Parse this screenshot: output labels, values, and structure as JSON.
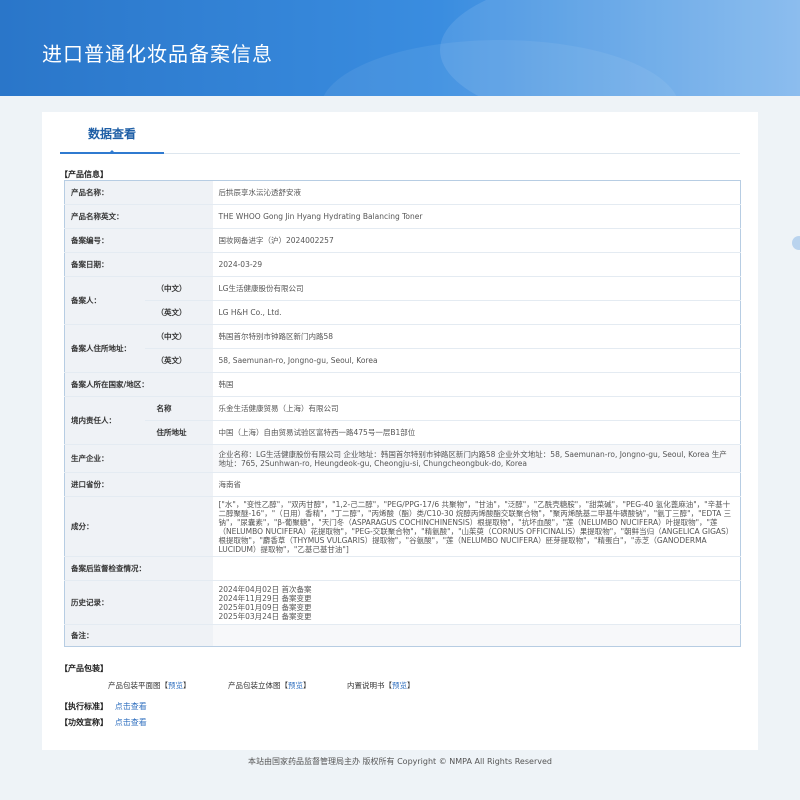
{
  "header": {
    "title": "进口普通化妆品备案信息"
  },
  "tabs": [
    {
      "label": "数据查看"
    }
  ],
  "sections": {
    "product_info": "【产品信息】",
    "packaging": "【产品包装】",
    "standard": "【执行标准】",
    "efficacy": "【功效宣称】"
  },
  "fields": {
    "name_label": "产品名称：",
    "name": "后拱辰享水沄沁透舒安液",
    "name_en_label": "产品名称英文：",
    "name_en": "THE WHOO Gong Jin Hyang Hydrating Balancing Toner",
    "record_no_label": "备案编号：",
    "record_no": "国妆网备进字（沪）2024002257",
    "record_date_label": "备案日期：",
    "record_date": "2024-03-29",
    "registrant_label": "备案人：",
    "cn_label": "（中文）",
    "en_label": "（英文）",
    "registrant_cn": "LG生活健康股份有限公司",
    "registrant_en": "LG H&H Co., Ltd.",
    "address_label": "备案人住所地址：",
    "address_cn": "韩国首尔特别市钟路区新门内路58",
    "address_en": "58, Saemunan-ro, Jongno-gu, Seoul, Korea",
    "country_label": "备案人所在国家/地区：",
    "country": "韩国",
    "domestic_label": "境内责任人：",
    "domestic_name_label": "名称",
    "domestic_name": "乐金生活健康贸易（上海）有限公司",
    "domestic_addr_label": "住所地址",
    "domestic_addr": "中国（上海）自由贸易试验区富特西一路475号一层B1部位",
    "manufacturer_label": "生产企业：",
    "manufacturer": "企业名称：LG生活健康股份有限公司 企业地址：韩国首尔特别市钟路区新门内路58 企业外文地址：58, Saemunan-ro, Jongno-gu, Seoul, Korea 生产地址：765, 2Sunhwan-ro, Heungdeok-gu, Cheongju-si, Chungcheongbuk-do, Korea",
    "province_label": "进口省份：",
    "province": "海南省",
    "ingredients_label": "成分：",
    "ingredients": "[\"水\"，\"变性乙醇\"，\"双丙甘醇\"，\"1,2-己二醇\"，\"PEG/PPG-17/6 共聚物\"，\"甘油\"，\"泛醇\"，\"乙酰壳糖胺\"，\"甜菜碱\"，\"PEG-40 氢化蓖麻油\"，\"辛基十二醇聚醚-16\"，\"（日用）香精\"，\"丁二醇\"，\"丙烯酸（酯）类/C10-30 烷醇丙烯酸酯交联聚合物\"，\"聚丙烯酰基二甲基牛磺酸钠\"，\"氨丁三醇\"，\"EDTA 三钠\"，\"尿囊素\"，\"β-葡聚糖\"，\"天门冬（ASPARAGUS COCHINCHINENSIS）根提取物\"，\"抗坏血酸\"，\"莲（NELUMBO NUCIFERA）叶提取物\"，\"莲（NELUMBO NUCIFERA）花提取物\"，\"PEG-交联聚合物\"，\"精氨酸\"，\"山茱萸（CORNUS OFFICINALIS）果提取物\"，\"朝鲜当归（ANGELICA GIGAS）根提取物\"，\"麝香草（THYMUS VULGARIS）提取物\"，\"谷氨酸\"，\"莲（NELUMBO NUCIFERA）胚芽提取物\"，\"精蛋白\"，\"赤芝（GANODERMA LUCIDUM）提取物\"，\"乙基己基甘油\"]",
    "post_check_label": "备案后监督检查情况：",
    "post_check": "",
    "history_label": "历史记录：",
    "history": [
      "2024年04月02日 首次备案",
      "2024年11月29日 备案变更",
      "2025年01月09日 备案变更",
      "2025年03月24日 备案变更"
    ],
    "remark_label": "备注：",
    "remark": ""
  },
  "packaging": {
    "flat_label": "产品包装平面图",
    "solid_label": "产品包装立体图",
    "manual_label": "内置说明书",
    "preview": "预览",
    "bracket_open": "【",
    "bracket_close": "】"
  },
  "links": {
    "view": "点击查看"
  },
  "footer": {
    "text": "本站由国家药品监督管理局主办 版权所有 Copyright © NMPA All Rights Reserved"
  },
  "colors": {
    "banner": "#2f7ad0",
    "link": "#2f6fbf",
    "label_bg": "#eff2f6",
    "border": "#b7cde3"
  }
}
